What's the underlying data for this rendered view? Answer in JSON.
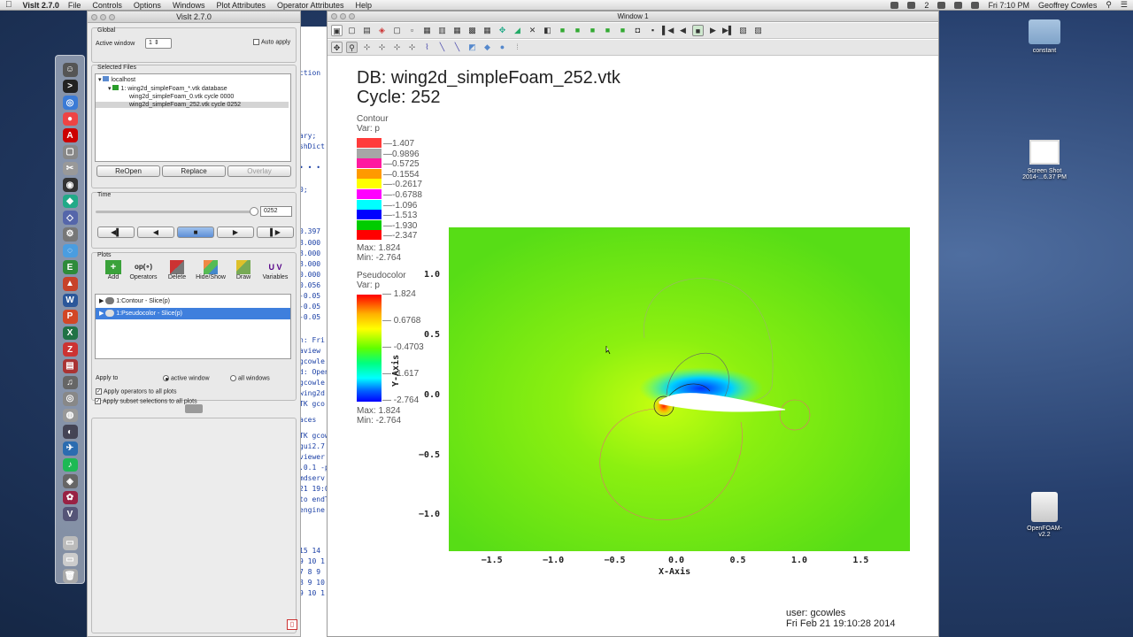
{
  "menubar": {
    "app_name": "VisIt 2.7.0",
    "items": [
      "File",
      "Controls",
      "Options",
      "Windows",
      "Plot Attributes",
      "Operator Attributes",
      "Help"
    ],
    "badge": "2",
    "clock": "Fri 7:10 PM",
    "user": "Geoffrey Cowles"
  },
  "gui": {
    "title": "VisIt 2.7.0",
    "global_label": "Global",
    "active_window_label": "Active window",
    "active_window_value": "1",
    "auto_apply_label": "Auto apply",
    "selected_files_label": "Selected Files",
    "tree": {
      "host": "localhost",
      "database": "1: wing2d_simpleFoam_*.vtk database",
      "file_a": "wing2d_simpleFoam_0.vtk cycle 0000",
      "file_b": "wing2d_simpleFoam_252.vtk cycle 0252"
    },
    "reopen_label": "ReOpen",
    "replace_label": "Replace",
    "overlay_label": "Overlay",
    "time_label": "Time",
    "time_value": "0252",
    "plots_label": "Plots",
    "toolbar": {
      "add": "Add",
      "operators": "Operators",
      "delete": "Delete",
      "hide_show": "Hide/Show",
      "draw": "Draw",
      "variables": "Variables"
    },
    "plots": [
      "1:Contour - Slice(p)",
      "1:Pseudocolor - Slice(p)"
    ],
    "apply_to_label": "Apply to",
    "active_window_radio": "active window",
    "all_windows_radio": "all windows",
    "apply_ops_label": "Apply operators to all plots",
    "apply_subset_label": "Apply subset selections to all plots"
  },
  "window1": {
    "title": "Window 1",
    "db_line": "DB: wing2d_simpleFoam_252.vtk",
    "cycle_line": "Cycle: 252",
    "contour_legend": {
      "title": "Contour",
      "var": "Var: p",
      "levels": [
        "1.407",
        "0.9896",
        "0.5725",
        "0.1554",
        "-0.2617",
        "-0.6788",
        "-1.096",
        "-1.513",
        "-1.930",
        "-2.347"
      ],
      "colors": [
        "#ff3b3b",
        "#a6a6a6",
        "#ff1aa0",
        "#ff9a00",
        "#ffff00",
        "#ff00ff",
        "#00ffff",
        "#0000ff",
        "#00cc00",
        "#ff0000"
      ],
      "max": "Max: 1.824",
      "min": "Min: -2.764"
    },
    "pseudo_legend": {
      "title": "Pseudocolor",
      "var": "Var: p",
      "ticks": [
        "1.824",
        "0.6768",
        "-0.4703",
        "-1.617",
        "-2.764"
      ],
      "max": "Max: 1.824",
      "min": "Min: -2.764"
    },
    "x_axis_label": "X-Axis",
    "y_axis_label": "Y-Axis",
    "x_ticks": [
      "−1.5",
      "−1.0",
      "−0.5",
      "0.0",
      "0.5",
      "1.0",
      "1.5"
    ],
    "y_ticks": [
      "1.0",
      "0.5",
      "0.0",
      "−0.5",
      "−1.0"
    ],
    "user_line": "user: gcowles",
    "date_line": "Fri Feb 21 19:10:28 2014"
  },
  "desktop": {
    "folder": "constant",
    "screenshot_line1": "Screen Shot",
    "screenshot_line2": "2014-...6.37 PM",
    "disk_line1": "OpenFOAM-",
    "disk_line2": "v2.2"
  },
  "terminal": {
    "lines": [
      {
        "y": 78,
        "t": "ction"
      },
      {
        "y": 149,
        "t": "ary;"
      },
      {
        "y": 161,
        "t": "shDict"
      },
      {
        "y": 185,
        "t": "• • •"
      },
      {
        "y": 210,
        "t": "0;"
      },
      {
        "y": 257,
        "t": "0.397"
      },
      {
        "y": 270,
        "t": "8.000"
      },
      {
        "y": 282,
        "t": "8.000"
      },
      {
        "y": 294,
        "t": "8.000"
      },
      {
        "y": 306,
        "t": "0.000"
      },
      {
        "y": 318,
        "t": "0.056"
      },
      {
        "y": 330,
        "t": "-0.05"
      },
      {
        "y": 342,
        "t": "-0.05"
      },
      {
        "y": 354,
        "t": "-0.05"
      },
      {
        "y": 380,
        "t": "n: Fri"
      },
      {
        "y": 392,
        "t": "aview"
      },
      {
        "y": 404,
        "t": "gcowle"
      },
      {
        "y": 416,
        "t": "d: Open"
      },
      {
        "y": 428,
        "t": "gcowle"
      },
      {
        "y": 440,
        "t": "wing2d"
      },
      {
        "y": 452,
        "t": "TK gco"
      },
      {
        "y": 470,
        "t": "aces"
      },
      {
        "y": 488,
        "t": "TK gcow"
      },
      {
        "y": 500,
        "t": "gui2.7"
      },
      {
        "y": 512,
        "t": "viewer"
      },
      {
        "y": 524,
        "t": ".0.1 -p"
      },
      {
        "y": 536,
        "t": "mdserv"
      },
      {
        "y": 548,
        "t": "21 19:0"
      },
      {
        "y": 560,
        "t": "to endT"
      },
      {
        "y": 572,
        "t": "engine"
      },
      {
        "y": 618,
        "t": "15 14"
      },
      {
        "y": 630,
        "t": "9 10 1"
      },
      {
        "y": 642,
        "t": "7 8 9"
      },
      {
        "y": 654,
        "t": "8 9 10"
      },
      {
        "y": 666,
        "t": "9 10 1"
      }
    ]
  },
  "colors": {
    "field": "#57dd16",
    "selection": "#3f7fdd",
    "desktop": "#2a4a7e"
  }
}
